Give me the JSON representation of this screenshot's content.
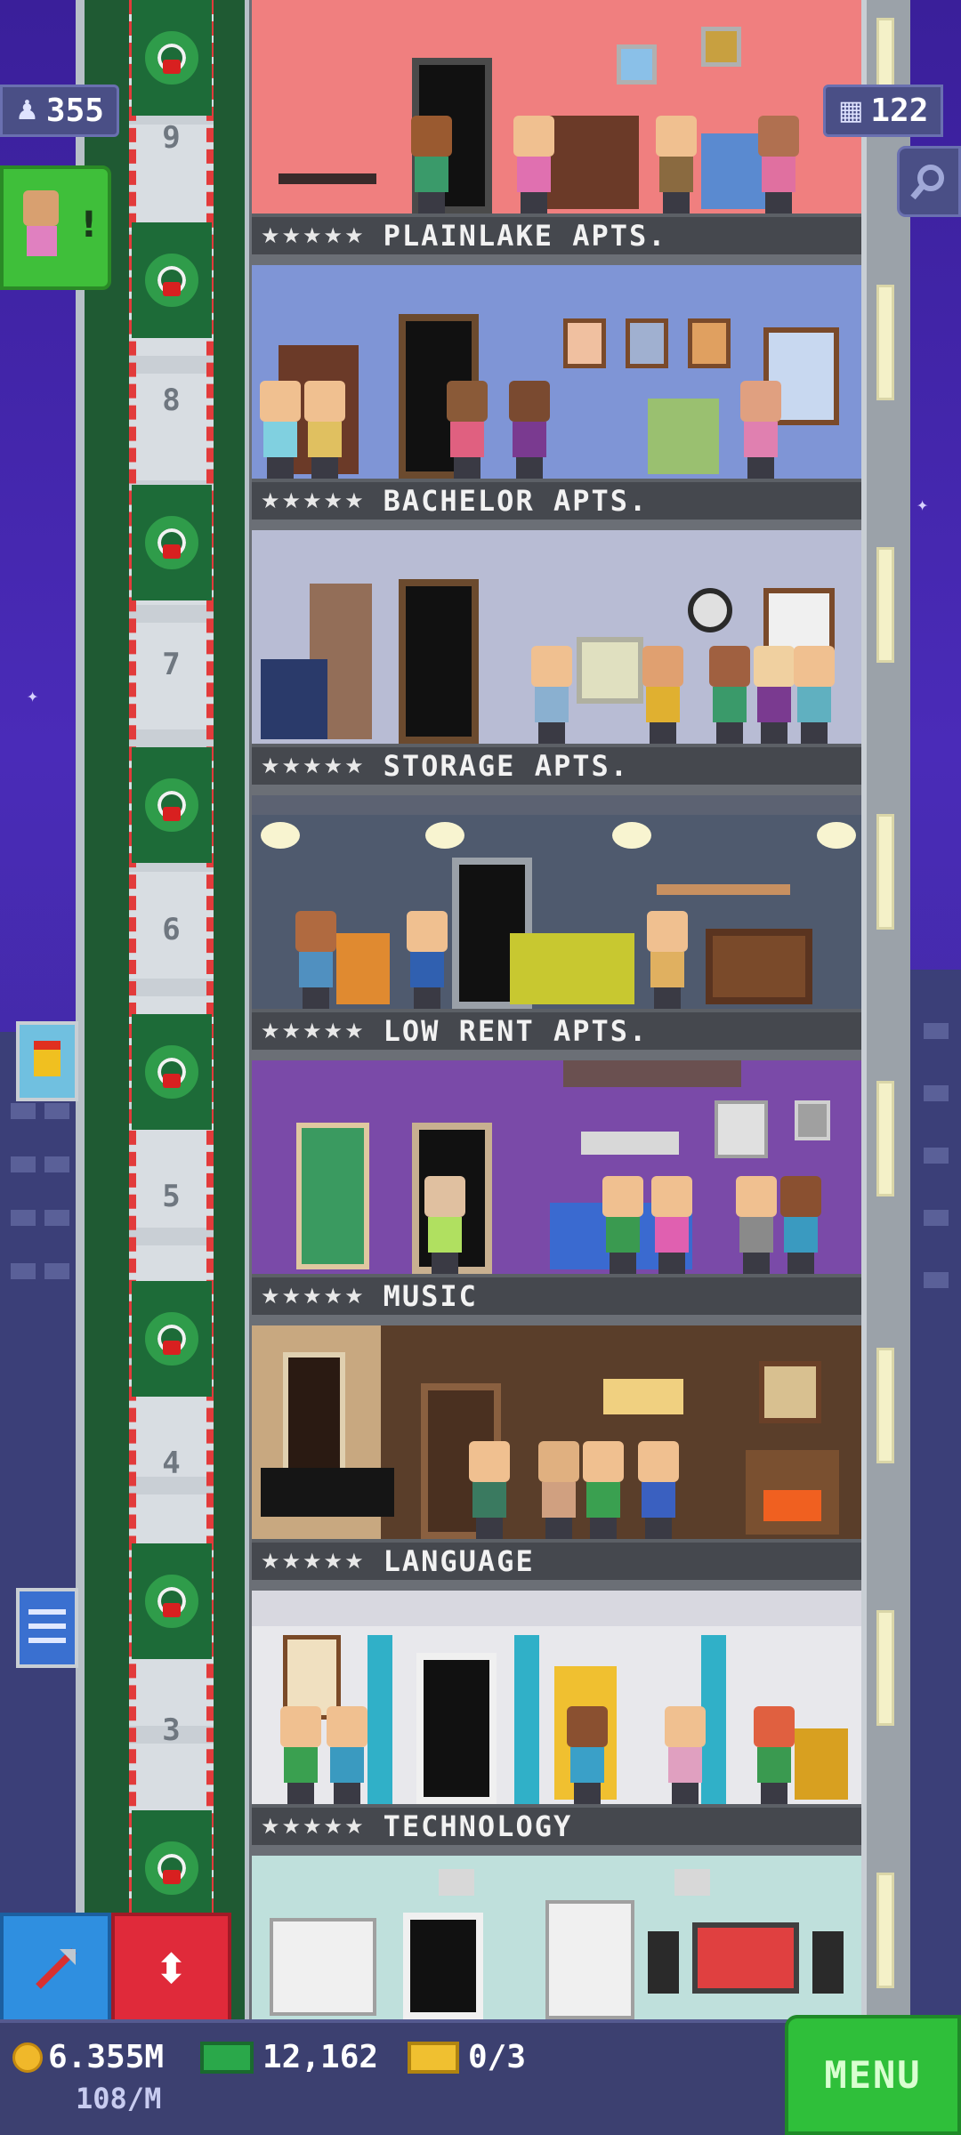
{
  "hud": {
    "population": "355",
    "population_icon": "person-icon",
    "floors": "122",
    "floors_icon": "building-icon",
    "search_icon": "magnifier-icon"
  },
  "elevator": {
    "floor_numbers": [
      "9",
      "8",
      "7",
      "6",
      "5",
      "4",
      "3"
    ]
  },
  "floors": [
    {
      "stars": "★★★★★",
      "name": "PLAINLAKE APTS.",
      "bg": "#f08080"
    },
    {
      "stars": "★★★★★",
      "name": "BACHELOR APTS.",
      "bg": "#7f95d6"
    },
    {
      "stars": "★★★★★",
      "name": "STORAGE APTS.",
      "bg": "#b8bcd4"
    },
    {
      "stars": "★★★★★",
      "name": "LOW RENT APTS.",
      "bg": "#4f5a6e"
    },
    {
      "stars": "★★★★★",
      "name": "MUSIC",
      "bg": "#7a4aa8"
    },
    {
      "stars": "★★★★★",
      "name": "LANGUAGE",
      "bg": "#5a3e2a"
    },
    {
      "stars": "★★★★★",
      "name": "TECHNOLOGY",
      "bg": "#e8e8ec"
    },
    {
      "stars": "",
      "name": "",
      "bg": "#bfe0dc"
    }
  ],
  "bottom": {
    "coins": "6.355M",
    "coin_rate": "108/M",
    "bux": "12,162",
    "tickets": "0/3",
    "menu_label": "MENU"
  },
  "colors": {
    "sky": "#4a2bb8",
    "accent_green": "#2fbf3a",
    "accent_red": "#e02a3a",
    "accent_blue": "#2f8fe0"
  }
}
